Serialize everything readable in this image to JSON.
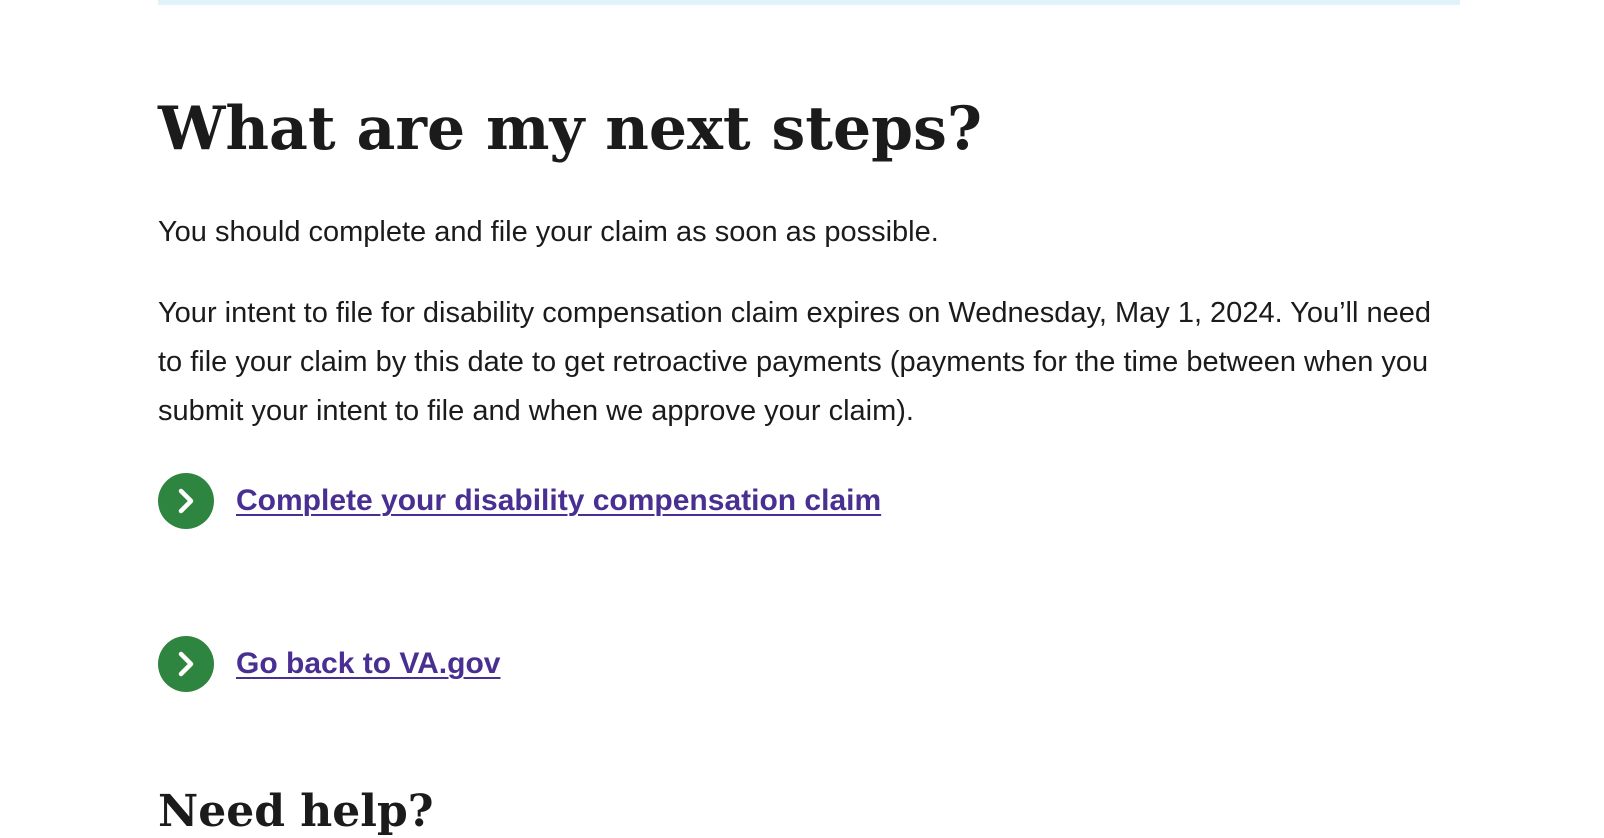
{
  "main": {
    "heading": "What are my next steps?",
    "paragraphs": [
      "You should complete and file your claim as soon as possible.",
      "Your intent to file for disability compensation claim expires on Wednesday, May 1, 2024. You’ll need to file your claim by this date to get retroactive payments (payments for the time between when you submit your intent to file and when we approve your claim)."
    ],
    "action_links": [
      {
        "label": "Complete your disability compensation claim",
        "icon": "chevron-right-circle-icon"
      },
      {
        "label": "Go back to VA.gov",
        "icon": "chevron-right-circle-icon"
      }
    ]
  },
  "help": {
    "heading": "Need help?"
  },
  "colors": {
    "link": "#4a2f92",
    "action_icon_bg": "#2e8540",
    "top_border": "#e1f3f8",
    "help_rule": "#005ea2",
    "text": "#1b1b1b"
  }
}
